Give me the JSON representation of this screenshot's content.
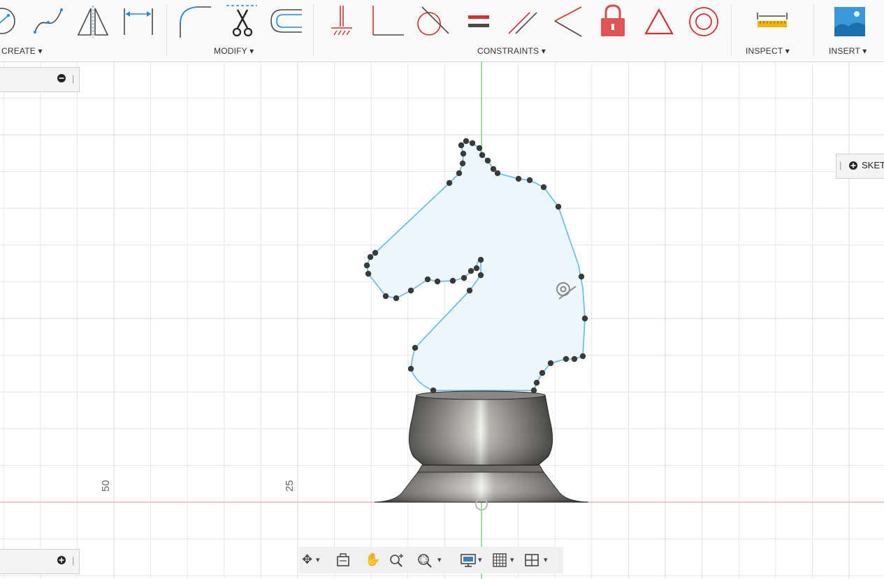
{
  "toolbar": {
    "groups": {
      "create": "CREATE ▾",
      "modify": "MODIFY ▾",
      "constraints": "CONSTRAINTS ▾",
      "inspect": "INSPECT ▾",
      "insert": "INSERT ▾"
    },
    "icons": {
      "create": [
        "circle-icon",
        "spline-icon",
        "mirror-icon",
        "dimension-icon"
      ],
      "modify": [
        "fillet-icon",
        "trim-icon",
        "offset-icon"
      ],
      "constraints": [
        "fix-icon",
        "perpendicular-icon",
        "tangent-icon",
        "equal-icon",
        "parallel-icon",
        "coincident-icon",
        "lock-icon",
        "triangle-icon",
        "concentric-icon"
      ],
      "inspect": [
        "measure-icon"
      ],
      "insert": [
        "insert-image-icon"
      ]
    }
  },
  "canvas": {
    "axis_labels": [
      "50",
      "25"
    ],
    "colors": {
      "grid": "#e6e6e6",
      "x_axis": "#e8a3a3",
      "y_axis": "#55cc55",
      "profile_fill": "#eef6fd",
      "profile_stroke": "#6cc0ea",
      "point": "#3a3a3a"
    }
  },
  "panels": {
    "top_left_icon": "collapse-icon",
    "bottom_left_icon": "expand-icon"
  },
  "sketch_palette": {
    "label": "SKET",
    "icon": "expand-icon"
  },
  "navbar": {
    "icons": [
      "orbit-icon",
      "look-at-icon",
      "pan-icon",
      "zoom-icon",
      "fit-icon",
      "display-settings-icon",
      "grid-settings-icon",
      "viewports-icon"
    ]
  }
}
